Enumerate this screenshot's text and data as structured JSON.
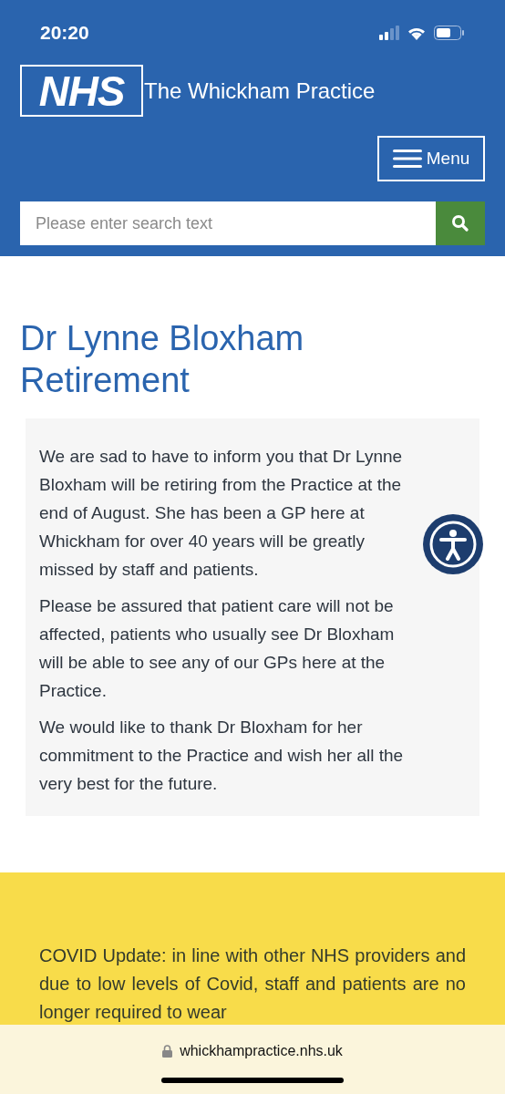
{
  "status_bar": {
    "time": "20:20"
  },
  "header": {
    "logo": "NHS",
    "site_name": "The Whickham Practice",
    "menu_button": "Menu",
    "search": {
      "placeholder": "Please enter search text"
    }
  },
  "article": {
    "title": "Dr Lynne Bloxham Retirement",
    "paragraphs": [
      "We are sad to have to inform you that Dr Lynne Bloxham will be retiring from the Practice at the end of August.  She has been a GP here at Whickham for over 40 years will be greatly missed by staff and patients.",
      "Please be assured that patient care will not be affected, patients who usually see Dr Bloxham will be able to see any of our GPs here at the Practice.",
      "We would like to thank Dr Bloxham for her commitment to the Practice and wish her all the very best for the future."
    ]
  },
  "notice": {
    "text": "COVID Update: in line with other NHS providers and due to low levels of Covid, staff and patients are no longer required to wear"
  },
  "browser_bar": {
    "url": "whickhampractice.nhs.uk"
  }
}
